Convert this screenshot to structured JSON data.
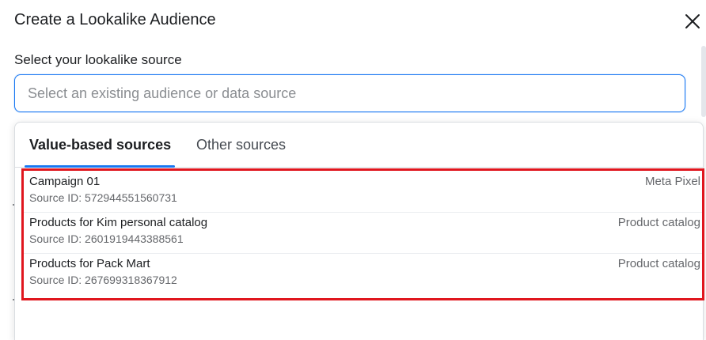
{
  "dialog": {
    "title": "Create a Lookalike Audience",
    "close_icon": "close-icon"
  },
  "source": {
    "label": "Select your lookalike source",
    "placeholder": "Select an existing audience or data source",
    "value": ""
  },
  "tabs": [
    {
      "label": "Value-based sources",
      "active": true
    },
    {
      "label": "Other sources",
      "active": false
    }
  ],
  "sources": [
    {
      "name": "Campaign 01",
      "id_text": "Source ID: 572944551560731",
      "type": "Meta Pixel"
    },
    {
      "name": "Products for Kim personal catalog",
      "id_text": "Source ID: 2601919443388561",
      "type": "Product catalog"
    },
    {
      "name": "Products for Pack Mart",
      "id_text": "Source ID: 267699318367912",
      "type": "Product catalog"
    }
  ],
  "colors": {
    "accent": "#1877f2",
    "highlight": "#e0161e"
  }
}
